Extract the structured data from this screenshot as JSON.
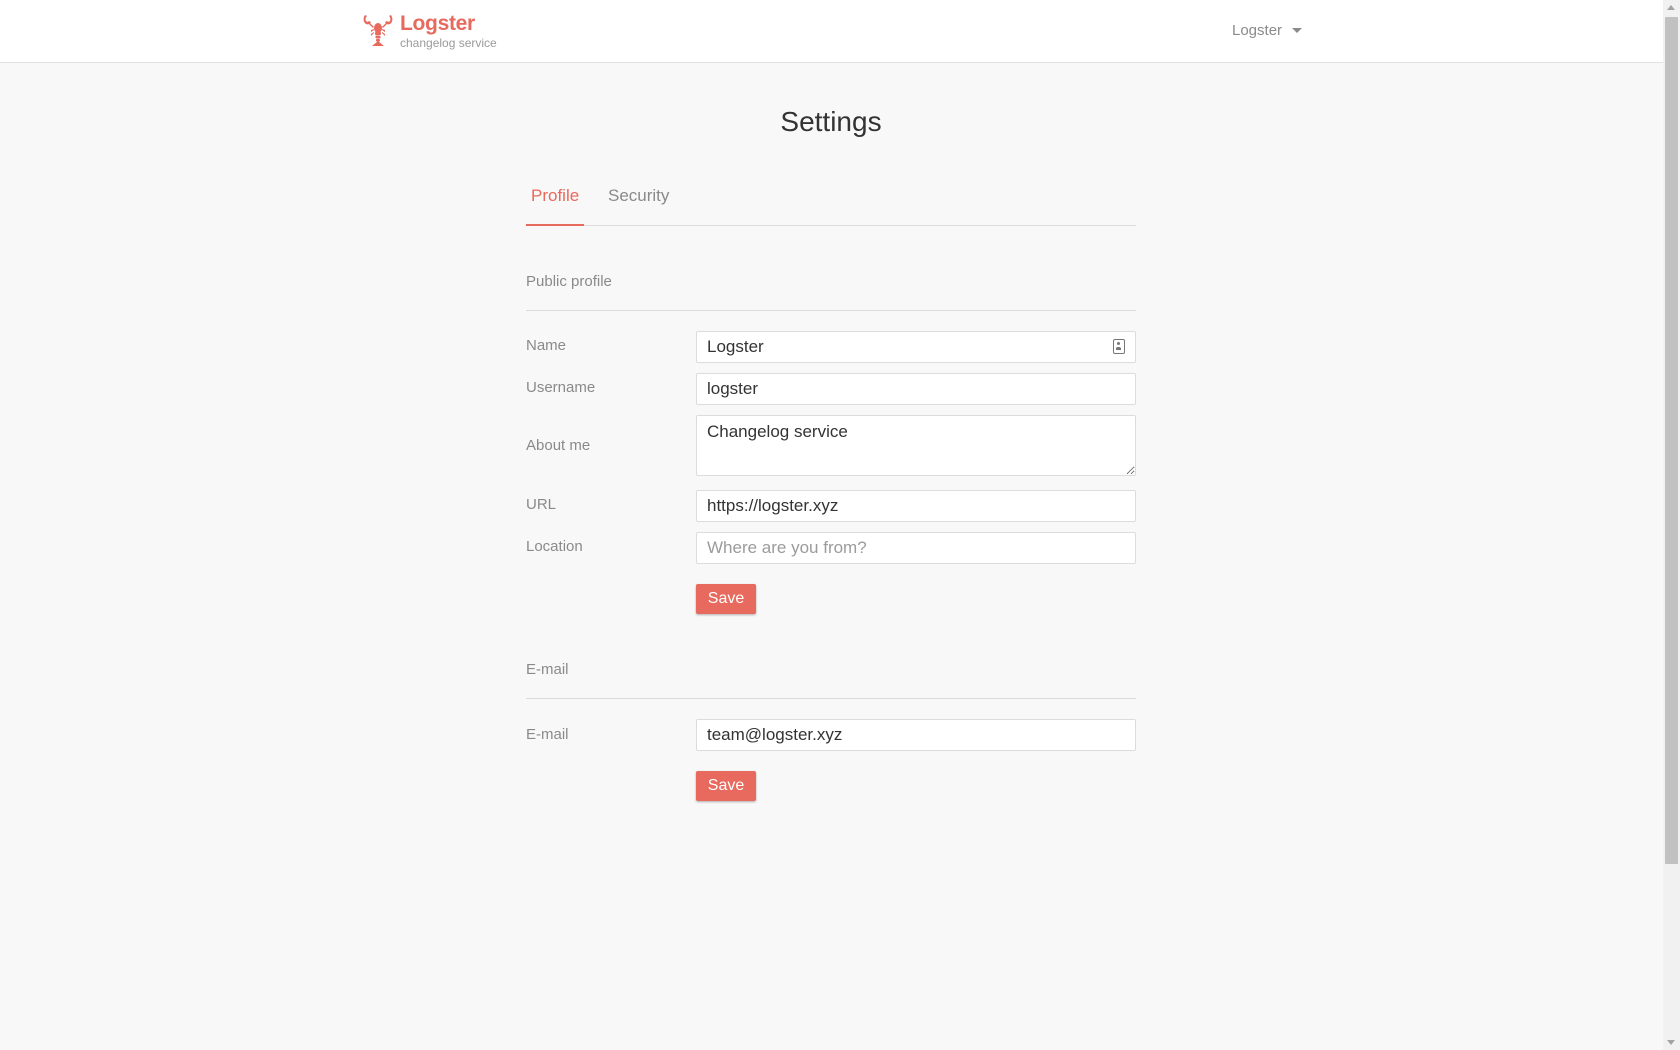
{
  "brand": {
    "name": "Logster",
    "tagline": "changelog service",
    "accent_color": "#e8695d",
    "logo_icon": "lobster-icon"
  },
  "user_menu": {
    "label": "Logster"
  },
  "page": {
    "title": "Settings"
  },
  "tabs": [
    {
      "label": "Profile",
      "active": true
    },
    {
      "label": "Security",
      "active": false
    }
  ],
  "public_profile": {
    "heading": "Public profile",
    "fields": {
      "name": {
        "label": "Name",
        "value": "Logster"
      },
      "username": {
        "label": "Username",
        "value": "logster"
      },
      "about": {
        "label": "About me",
        "value": "Changelog service"
      },
      "url": {
        "label": "URL",
        "value": "https://logster.xyz"
      },
      "location": {
        "label": "Location",
        "value": "",
        "placeholder": "Where are you from?"
      }
    },
    "save_label": "Save"
  },
  "email_section": {
    "heading": "E-mail",
    "field": {
      "label": "E-mail",
      "value": "team@logster.xyz"
    },
    "save_label": "Save"
  }
}
